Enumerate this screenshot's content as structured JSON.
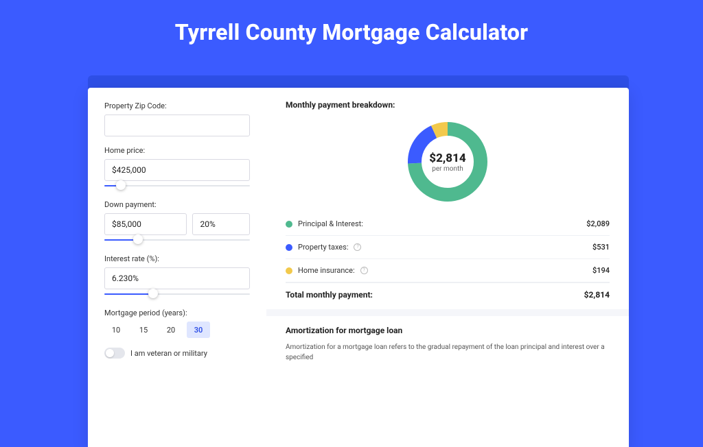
{
  "hero": {
    "title": "Tyrrell County Mortgage Calculator"
  },
  "form": {
    "zip_label": "Property Zip Code:",
    "zip_value": "",
    "price_label": "Home price:",
    "price_value": "$425,000",
    "down_label": "Down payment:",
    "down_value": "$85,000",
    "down_pct": "20%",
    "rate_label": "Interest rate (%):",
    "rate_value": "6.230%",
    "period_label": "Mortgage period (years):",
    "periods": [
      "10",
      "15",
      "20",
      "30"
    ],
    "period_active": "30",
    "veteran_label": "I am veteran or military"
  },
  "breakdown": {
    "title": "Monthly payment breakdown:",
    "donut_amount": "$2,814",
    "donut_sub": "per month",
    "items": [
      {
        "label": "Principal & Interest:",
        "color": "#4fb98f",
        "value": "$2,089",
        "info": false
      },
      {
        "label": "Property taxes:",
        "color": "#3b5bff",
        "value": "$531",
        "info": true
      },
      {
        "label": "Home insurance:",
        "color": "#f2c94c",
        "value": "$194",
        "info": true
      }
    ],
    "total_label": "Total monthly payment:",
    "total_value": "$2,814"
  },
  "amort": {
    "title": "Amortization for mortgage loan",
    "text": "Amortization for a mortgage loan refers to the gradual repayment of the loan principal and interest over a specified"
  },
  "chart_data": {
    "type": "pie",
    "title": "Monthly payment breakdown",
    "series": [
      {
        "name": "Principal & Interest",
        "value": 2089,
        "color": "#4fb98f"
      },
      {
        "name": "Property taxes",
        "value": 531,
        "color": "#3b5bff"
      },
      {
        "name": "Home insurance",
        "value": 194,
        "color": "#f2c94c"
      }
    ],
    "total": 2814,
    "center_label": "$2,814 per month"
  }
}
